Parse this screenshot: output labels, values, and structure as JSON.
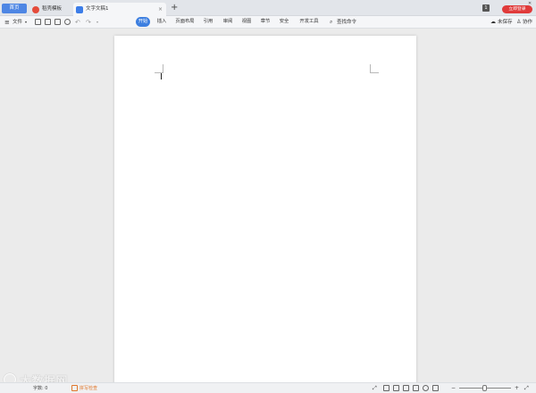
{
  "tabs": {
    "home": "首页",
    "template": "稻壳模板",
    "document": "文字文稿1",
    "close": "×",
    "add": "+"
  },
  "window": {
    "login": "立即登录",
    "badge": "1",
    "minimize": "—",
    "restore": "❐",
    "close": "✕"
  },
  "toolbar": {
    "menu_icon": "≡",
    "file": "文件",
    "file_arrow": "▾",
    "undo": "↶",
    "redo": "↷",
    "more": "▾",
    "save_status": "未保存",
    "collab": "协作",
    "search": "查找命令",
    "menus": [
      "开始",
      "插入",
      "页面布局",
      "引用",
      "审阅",
      "视图",
      "章节",
      "安全",
      "开发工具"
    ]
  },
  "status": {
    "word_count": "字数: 0",
    "spell_check": "拼写检查",
    "zoom_minus": "−",
    "zoom_plus": "+",
    "fullscreen": "⤢"
  },
  "watermark": "大数据网"
}
